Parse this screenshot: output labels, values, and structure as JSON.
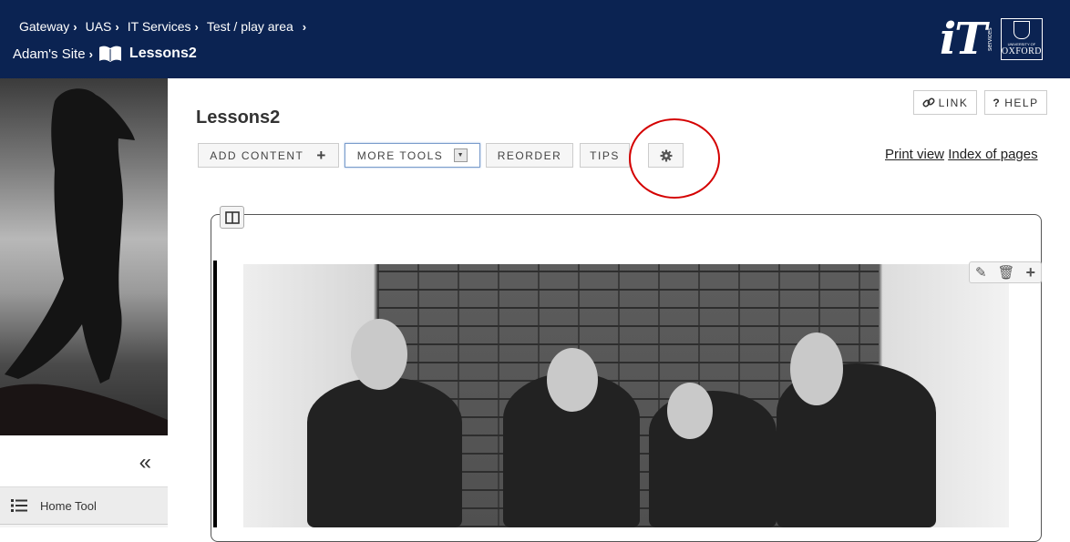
{
  "header": {
    "breadcrumbs": [
      "Gateway",
      "UAS",
      "IT Services",
      "Test / play area"
    ],
    "site_name": "Adam's Site",
    "tool_name": "Lessons2",
    "brand": {
      "it_logo": "iT",
      "it_services": "services",
      "university_label": "UNIVERSITY OF",
      "university_name": "OXFORD"
    }
  },
  "sidebar": {
    "collapse_label": "«",
    "tool_label": "Home Tool"
  },
  "main": {
    "page_title": "Lessons2",
    "link_button": "LINK",
    "help_button": "HELP",
    "toolbar": {
      "add_content": "ADD CONTENT",
      "more_tools": "MORE TOOLS",
      "reorder": "REORDER",
      "tips": "TIPS"
    },
    "print_view": "Print view",
    "index_of_pages": "Index of pages"
  },
  "colors": {
    "header_bg": "#0b2352",
    "highlight": "#d40000"
  }
}
